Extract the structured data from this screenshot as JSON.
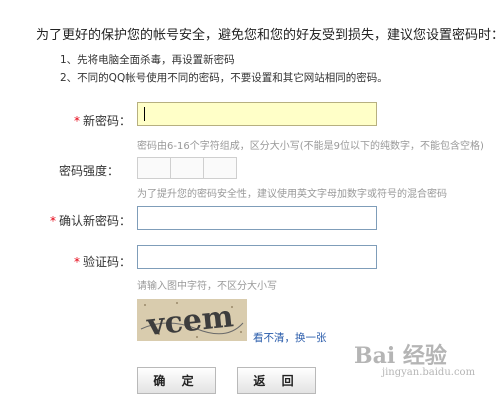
{
  "intro": "为了更好的保护您的帐号安全，避免您和您的好友受到损失，建议您设置密码时：",
  "tips": [
    "1、先将电脑全面杀毒，再设置新密码",
    "2、不同的QQ帐号使用不同的密码，不要设置和其它网站相同的密码。"
  ],
  "form": {
    "required_mark": "*",
    "new_password": {
      "label": "新密码：",
      "value": "",
      "hint": "密码由6-16个字符组成，区分大小写(不能是9位以下的纯数字，不能包含空格)"
    },
    "strength": {
      "label": "密码强度：",
      "segments": [
        "",
        "",
        ""
      ],
      "hint": "为了提升您的密码安全性，建议使用英文字母加数字或符号的混合密码"
    },
    "confirm_password": {
      "label": "确认新密码：",
      "value": ""
    },
    "captcha": {
      "label": "验证码：",
      "value": "",
      "hint": "请输入图中字符，不区分大小写",
      "image_text": "vcem",
      "refresh_link": "看不清，换一张"
    }
  },
  "buttons": {
    "confirm": "确 定",
    "back": "返 回"
  },
  "watermark": {
    "logo": "Bai 经验",
    "url": "jingyan.baidu.com"
  }
}
